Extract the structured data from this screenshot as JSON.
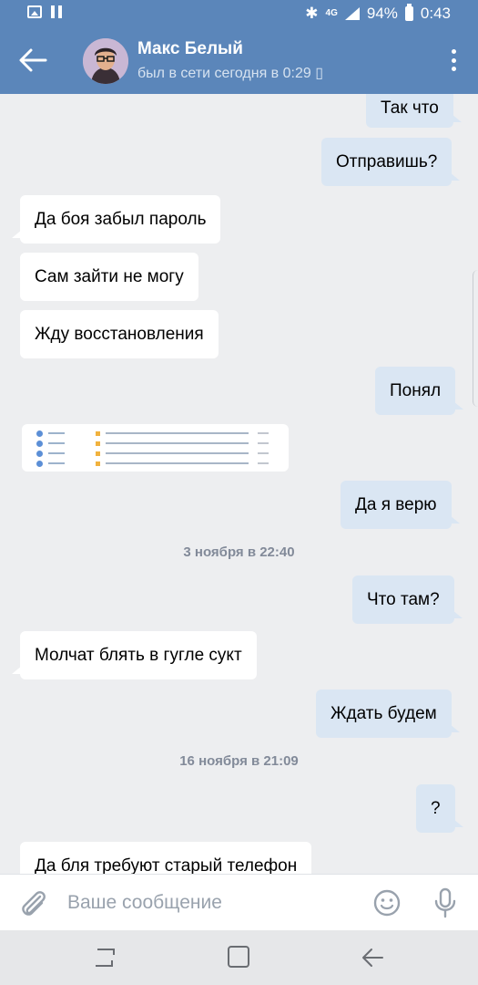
{
  "status_bar": {
    "network": "4G",
    "battery": "94%",
    "time": "0:43"
  },
  "header": {
    "contact_name": "Макс Белый",
    "contact_status": "был в сети сегодня в 0:29 ▯"
  },
  "messages": [
    {
      "side": "out",
      "text": "Так что"
    },
    {
      "side": "out",
      "text": "Отправишь?"
    },
    {
      "side": "in",
      "text": "Да боя забыл пароль"
    },
    {
      "side": "in",
      "text": "Сам зайти не могу"
    },
    {
      "side": "in",
      "text": "Жду восстановления"
    },
    {
      "side": "out",
      "text": "Понял"
    },
    {
      "side": "in",
      "type": "image",
      "icon": "gmail-inbox-screenshot"
    },
    {
      "side": "out",
      "text": "Да я верю"
    },
    {
      "side": "out",
      "text": "Что там?"
    },
    {
      "side": "in",
      "text": "Молчат блять в гугле сукт"
    },
    {
      "side": "out",
      "text": "Ждать будем"
    },
    {
      "side": "out",
      "text": "?"
    },
    {
      "side": "in",
      "text": "Да бля требуют старый телефон"
    }
  ],
  "date_separators": [
    "3 ноября в 22:40",
    "16 ноября в 21:09"
  ],
  "composer": {
    "placeholder": "Ваше сообщение"
  },
  "colors": {
    "header": "#5b86ba",
    "background": "#edeef0",
    "outgoing_bubble": "#dae6f3",
    "incoming_bubble": "#ffffff"
  }
}
